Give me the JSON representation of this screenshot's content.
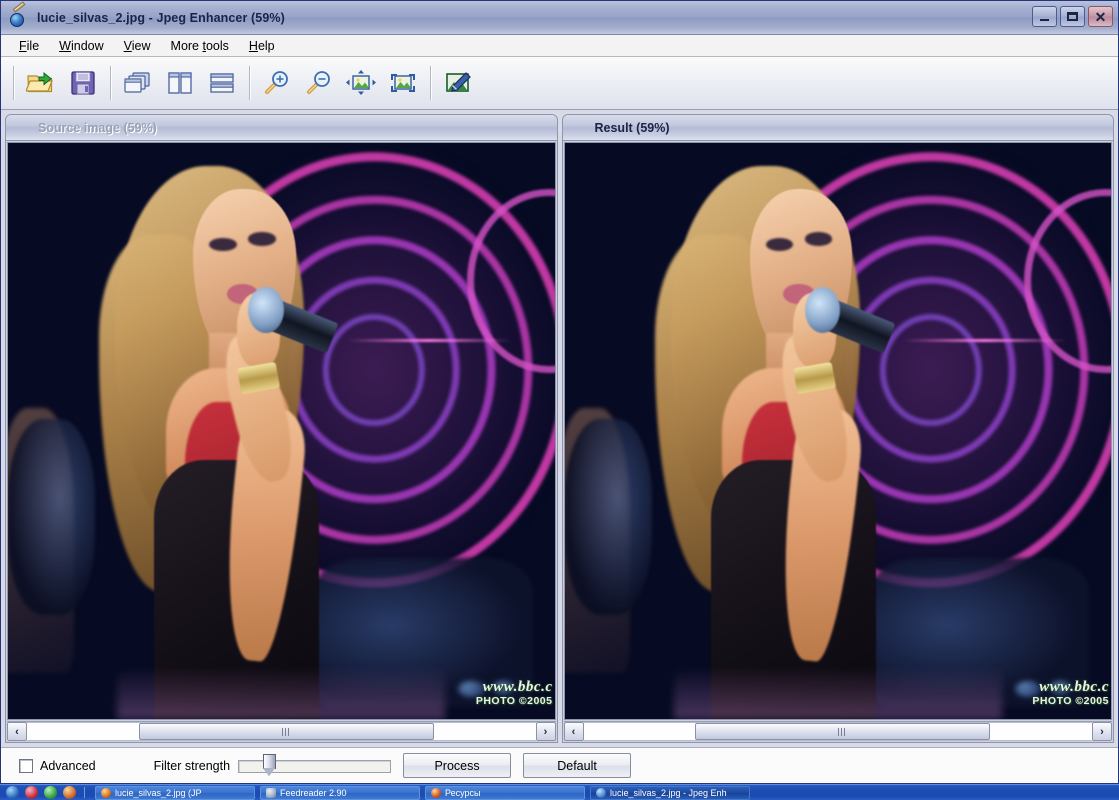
{
  "window": {
    "title": "lucie_silvas_2.jpg - Jpeg Enhancer (59%)",
    "app_icon": "image-pen-icon",
    "controls": {
      "minimize": "minimize-icon",
      "restore": "restore-icon",
      "close": "close-icon"
    }
  },
  "menu": [
    {
      "pre": "",
      "accel": "F",
      "post": "ile"
    },
    {
      "pre": "",
      "accel": "W",
      "post": "indow"
    },
    {
      "pre": "",
      "accel": "V",
      "post": "iew"
    },
    {
      "pre": "More ",
      "accel": "t",
      "post": "ools"
    },
    {
      "pre": "",
      "accel": "H",
      "post": "elp"
    }
  ],
  "toolbar": {
    "groups": [
      [
        {
          "name": "open-file-button",
          "icon": "open-folder-icon",
          "tooltip": "Open"
        },
        {
          "name": "save-file-button",
          "icon": "floppy-save-icon",
          "tooltip": "Save"
        }
      ],
      [
        {
          "name": "cascade-windows-button",
          "icon": "cascade-windows-icon",
          "tooltip": "Cascade"
        },
        {
          "name": "tile-vertical-button",
          "icon": "tile-vertical-icon",
          "tooltip": "Tile vertically"
        },
        {
          "name": "tile-horizontal-button",
          "icon": "tile-horizontal-icon",
          "tooltip": "Tile horizontally"
        }
      ],
      [
        {
          "name": "zoom-in-button",
          "icon": "magnifier-plus-icon",
          "tooltip": "Zoom in"
        },
        {
          "name": "zoom-out-button",
          "icon": "magnifier-minus-icon",
          "tooltip": "Zoom out"
        },
        {
          "name": "fit-to-window-button",
          "icon": "fit-image-icon",
          "tooltip": "Fit to window"
        },
        {
          "name": "actual-size-button",
          "icon": "actual-size-icon",
          "tooltip": "Actual size"
        }
      ],
      [
        {
          "name": "enhance-button",
          "icon": "image-pen-edit-icon",
          "tooltip": "Enhance"
        }
      ]
    ]
  },
  "panels": {
    "source": {
      "title": "Source image (59%)",
      "state": "inactive",
      "scrollbar": {
        "left_arrow": "‹",
        "right_arrow": "›"
      }
    },
    "result": {
      "title": "Result (59%)",
      "state": "active",
      "scrollbar": {
        "left_arrow": "‹",
        "right_arrow": "›"
      }
    }
  },
  "photo": {
    "watermark_line1": "www.bbc.c",
    "watermark_line2": "PHOTO ©2005"
  },
  "controls": {
    "advanced_label": "Advanced",
    "advanced_checked": false,
    "filter_strength_label": "Filter strength",
    "filter_strength_value": 16,
    "process_label": "Process",
    "default_label": "Default"
  },
  "taskbar": {
    "quick_launch": [
      {
        "name": "quicklaunch-browser-icon"
      },
      {
        "name": "quicklaunch-media-icon"
      },
      {
        "name": "quicklaunch-paint-icon"
      },
      {
        "name": "quicklaunch-player-icon"
      }
    ],
    "tasks": [
      {
        "label": "lucie_silvas_2.jpg (JP",
        "icon": "jpeg-file-icon",
        "active": false
      },
      {
        "label": "Feedreader 2.90",
        "icon": "feedreader-icon",
        "active": false
      },
      {
        "label": "Ресурсы",
        "icon": "resources-icon",
        "active": false
      },
      {
        "label": "lucie_silvas_2.jpg - Jpeg Enh",
        "icon": "jpeg-enhancer-icon",
        "active": true
      }
    ]
  },
  "colors": {
    "titlebar": "#9aa6cc",
    "taskbar": "#1c4cb0",
    "accent": "#2f63c8",
    "photo_bg": "#060a22",
    "ring_pink": "#e040b8"
  }
}
